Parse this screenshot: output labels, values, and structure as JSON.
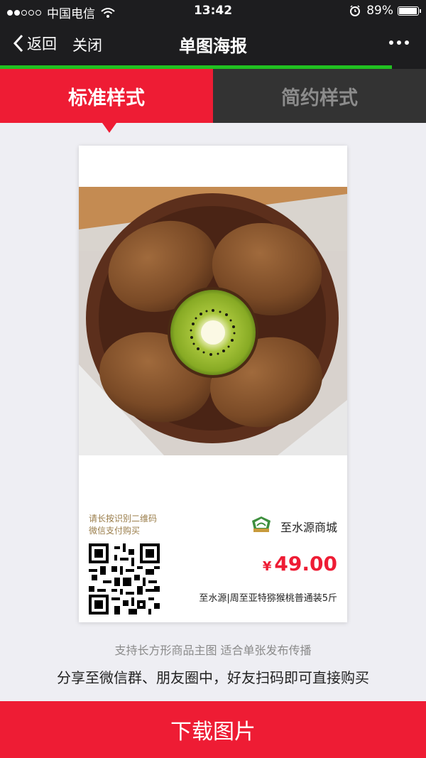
{
  "status_bar": {
    "carrier": "中国电信",
    "time": "13:42",
    "battery": "89%",
    "battery_level": 0.89,
    "signal_bars": 2,
    "icons": [
      "signal-dots-icon",
      "wifi-icon",
      "alarm-icon",
      "battery-icon"
    ]
  },
  "nav": {
    "back_label": "返回",
    "close_label": "关闭",
    "title": "单图海报",
    "more_icon": "more-dots-icon",
    "load_progress": 0.92
  },
  "tabs": [
    {
      "label": "标准样式",
      "active": true
    },
    {
      "label": "简约样式",
      "active": false
    }
  ],
  "poster": {
    "image_subject": "kiwifruit-photo",
    "qr_hint_line1": "请长按识别二维码",
    "qr_hint_line2": "微信支付购买",
    "shop_name": "至水源商城",
    "currency": "¥",
    "price": "49.00",
    "product_name": "至水源|周至亚特猕猴桃普通装5斤"
  },
  "tips": {
    "line1": "支持长方形商品主图 适合单张发布传播",
    "line2": "分享至微信群、朋友圈中，好友扫码即可直接购买"
  },
  "download_label": "下载图片",
  "colors": {
    "accent_red": "#ee1c34",
    "nav_dark": "#1d1d1f",
    "progress_green": "#21c021",
    "hint_brown": "#9a7d4a"
  }
}
